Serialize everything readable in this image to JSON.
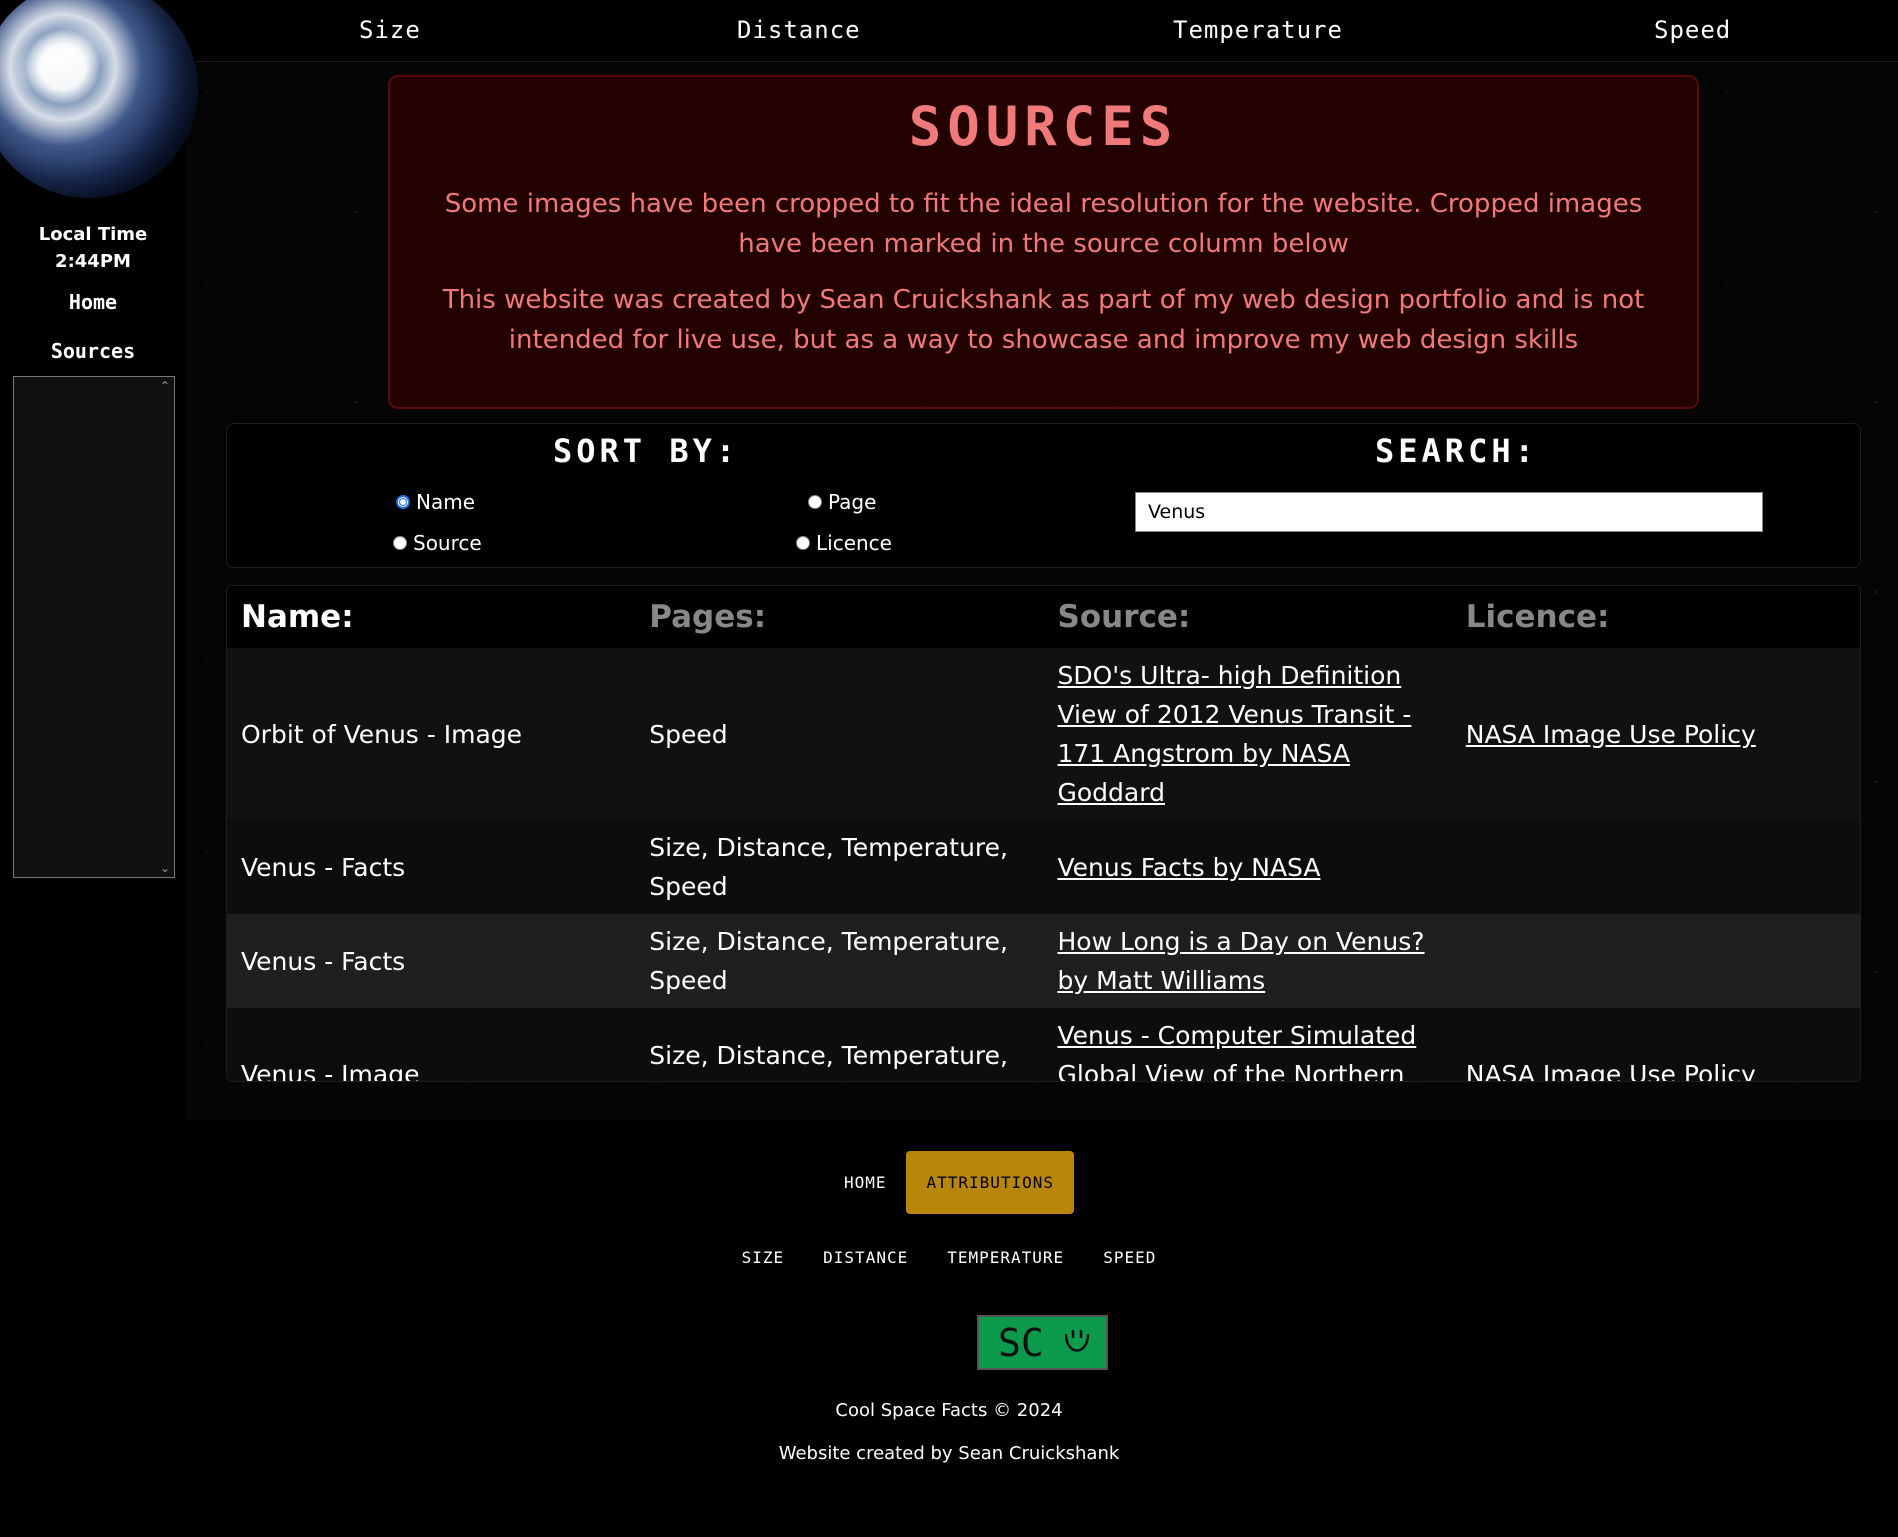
{
  "top_nav": [
    "Size",
    "Distance",
    "Temperature",
    "Speed"
  ],
  "sidebar": {
    "local_time_label": "Local Time",
    "local_time_value": "2:44PM",
    "links": [
      "Home",
      "Sources"
    ]
  },
  "sources": {
    "title": "SOURCES",
    "paragraph1": "Some images have been cropped to fit the ideal resolution for the website. Cropped images have been marked in the source column below",
    "paragraph2": "This website was created by Sean Cruickshank as part of my web design portfolio and is not intended for live use, but as a way to showcase and improve my web design skills"
  },
  "controls": {
    "sort_heading": "SORT BY:",
    "search_heading": "SEARCH:",
    "radios": [
      {
        "label": "Name",
        "checked": true
      },
      {
        "label": "Page",
        "checked": false
      },
      {
        "label": "Source",
        "checked": false
      },
      {
        "label": "Licence",
        "checked": false
      }
    ],
    "search_value": "Venus"
  },
  "table": {
    "headers": [
      "Name:",
      "Pages:",
      "Source:",
      "Licence:"
    ],
    "rows": [
      {
        "name": "Orbit of Venus - Image",
        "pages": "Speed",
        "source": "SDO's Ultra- high Definition View of 2012 Venus Transit - 171 Angstrom by NASA Goddard",
        "licence": "NASA Image Use Policy"
      },
      {
        "name": "Venus - Facts",
        "pages": "Size, Distance, Temperature, Speed",
        "source": "Venus Facts by NASA",
        "licence": ""
      },
      {
        "name": "Venus - Facts",
        "pages": "Size, Distance, Temperature, Speed",
        "source": "How Long is a Day on Venus? by Matt Williams",
        "licence": ""
      },
      {
        "name": "Venus - Image",
        "pages": "Size, Distance, Temperature, Speed",
        "source": "Venus - Computer Simulated Global View of the Northern Hemisphere by NASA/JPL",
        "licence": "NASA Image Use Policy"
      }
    ]
  },
  "footer": {
    "nav_primary": [
      "HOME",
      "ATTRIBUTIONS"
    ],
    "nav_secondary": [
      "SIZE",
      "DISTANCE",
      "TEMPERATURE",
      "SPEED"
    ],
    "logo_text": "SC",
    "copyright": "Cool Space Facts © 2024",
    "creator": "Website created by Sean Cruickshank"
  },
  "colors": {
    "sources_text": "#f07a7a",
    "active_footer": "#b8860b",
    "logo_bg": "#0c9a4c"
  }
}
